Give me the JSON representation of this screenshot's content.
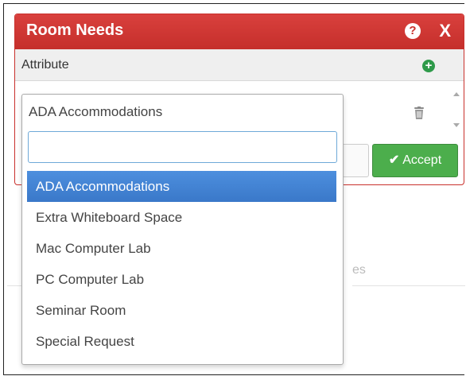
{
  "dialog": {
    "title": "Room Needs",
    "help_icon": "question-circle-icon",
    "close_icon": "close-icon",
    "close_glyph": "X",
    "help_glyph": "?",
    "attribute_header": "Attribute",
    "add_icon": "plus-circle-icon",
    "add_glyph": "+",
    "delete_icon": "trash-icon",
    "accept_label": "Accept",
    "accept_icon": "checkmark-icon",
    "accept_glyph": "✔"
  },
  "dropdown": {
    "selected_value": "ADA Accommodations",
    "search_value": "",
    "options": [
      "ADA Accommodations",
      "Extra Whiteboard Space",
      "Mac Computer Lab",
      "PC Computer Lab",
      "Seminar Room",
      "Special Request"
    ],
    "highlighted_index": 0
  },
  "background": {
    "partial_text": "es"
  },
  "colors": {
    "header_red": "#c9302c",
    "accept_green": "#4cae4c",
    "highlight_blue": "#3a78c9",
    "search_border": "#6ea9d8"
  }
}
